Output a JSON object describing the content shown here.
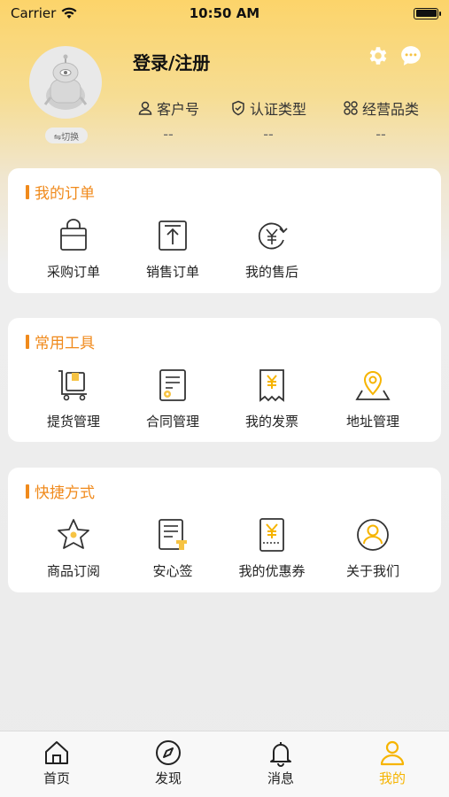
{
  "status_bar": {
    "carrier": "Carrier",
    "time": "10:50 AM"
  },
  "profile": {
    "switch_label": "⇋切换",
    "login_title": "登录/注册",
    "stats": [
      {
        "label": "客户号",
        "value": "--",
        "icon": "user-icon"
      },
      {
        "label": "认证类型",
        "value": "--",
        "icon": "shield-check-icon"
      },
      {
        "label": "经营品类",
        "value": "--",
        "icon": "grid-icon"
      }
    ]
  },
  "cards": {
    "orders": {
      "title": "我的订单",
      "items": [
        {
          "label": "采购订单",
          "icon": "shopping-bag-icon"
        },
        {
          "label": "销售订单",
          "icon": "upload-box-icon"
        },
        {
          "label": "我的售后",
          "icon": "refund-yen-icon"
        }
      ]
    },
    "tools": {
      "title": "常用工具",
      "items": [
        {
          "label": "提货管理",
          "icon": "cart-box-icon"
        },
        {
          "label": "合同管理",
          "icon": "contract-icon"
        },
        {
          "label": "我的发票",
          "icon": "invoice-yen-icon"
        },
        {
          "label": "地址管理",
          "icon": "map-pin-icon"
        }
      ]
    },
    "shortcuts": {
      "title": "快捷方式",
      "items": [
        {
          "label": "商品订阅",
          "icon": "star-icon"
        },
        {
          "label": "安心签",
          "icon": "sign-document-icon"
        },
        {
          "label": "我的优惠券",
          "icon": "coupon-yen-icon"
        },
        {
          "label": "关于我们",
          "icon": "about-user-icon"
        }
      ]
    }
  },
  "tabbar": {
    "tabs": [
      {
        "label": "首页",
        "icon": "home-icon"
      },
      {
        "label": "发现",
        "icon": "compass-icon"
      },
      {
        "label": "消息",
        "icon": "bell-icon"
      },
      {
        "label": "我的",
        "icon": "profile-icon",
        "active": true
      }
    ]
  },
  "colors": {
    "accent": "#f08a1c",
    "active_tab": "#f6b400",
    "highlight": "#f6c343"
  }
}
